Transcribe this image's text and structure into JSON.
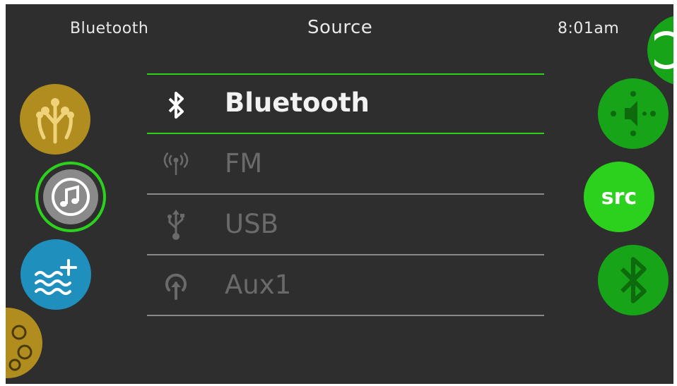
{
  "header": {
    "left_label": "Bluetooth",
    "title": "Source",
    "time": "8:01am"
  },
  "sources": [
    {
      "label": "Bluetooth",
      "icon": "bluetooth-icon",
      "selected": true
    },
    {
      "label": "FM",
      "icon": "radio-antenna-icon",
      "selected": false
    },
    {
      "label": "USB",
      "icon": "usb-icon",
      "selected": false
    },
    {
      "label": "Aux1",
      "icon": "aux-input-icon",
      "selected": false
    }
  ],
  "side_buttons": {
    "left": [
      "tree-icon",
      "music-note-icon",
      "water-plus-icon",
      "gears-icon"
    ],
    "right": [
      "power-icon",
      "volume-icon",
      "src",
      "bluetooth-icon"
    ],
    "src_label": "src"
  },
  "colors": {
    "background": "#2e2e2e",
    "selected_line": "#2bd11d",
    "green_button": "#18a418",
    "bright_green": "#2bd11d",
    "gold": "#b08d1e",
    "blue": "#1f8fbd",
    "selected_text": "#f2f2f2",
    "inactive_text": "#6a6a6a"
  }
}
